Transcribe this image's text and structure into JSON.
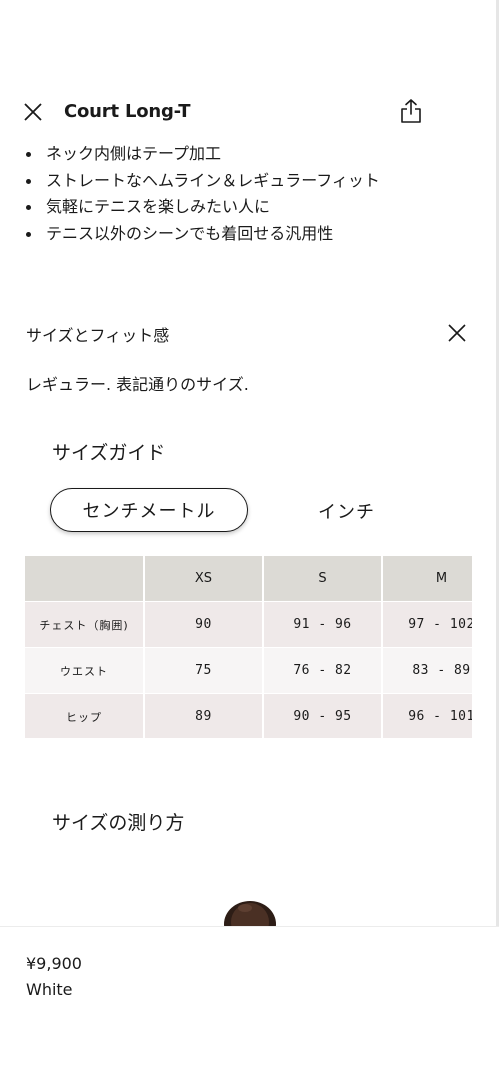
{
  "product": {
    "title": "Court Long-T",
    "features": [
      "ネック内側はテープ加工",
      "ストレートなヘムライン＆レギュラーフィット",
      "気軽にテニスを楽しみたい人に",
      "テニス以外のシーンでも着回せる汎用性"
    ],
    "price": "¥9,900",
    "color": "White"
  },
  "fit": {
    "title": "サイズとフィット感",
    "description": "レギュラー. 表記通りのサイズ."
  },
  "size_guide": {
    "title": "サイズガイド",
    "units": [
      "センチメートル",
      "インチ"
    ],
    "selected_unit": "センチメートル",
    "columns": [
      "",
      "XS",
      "S",
      "M"
    ],
    "rows": [
      {
        "label": "チェスト（胸囲)",
        "values": [
          "90",
          "91 - 96",
          "97 - 102"
        ]
      },
      {
        "label": "ウエスト",
        "values": [
          "75",
          "76 - 82",
          "83 - 89"
        ]
      },
      {
        "label": "ヒップ",
        "values": [
          "89",
          "90 - 95",
          "96 - 101"
        ]
      }
    ]
  },
  "measure": {
    "title": "サイズの測り方"
  },
  "icons": {
    "close": "close-icon",
    "share": "share-icon"
  }
}
